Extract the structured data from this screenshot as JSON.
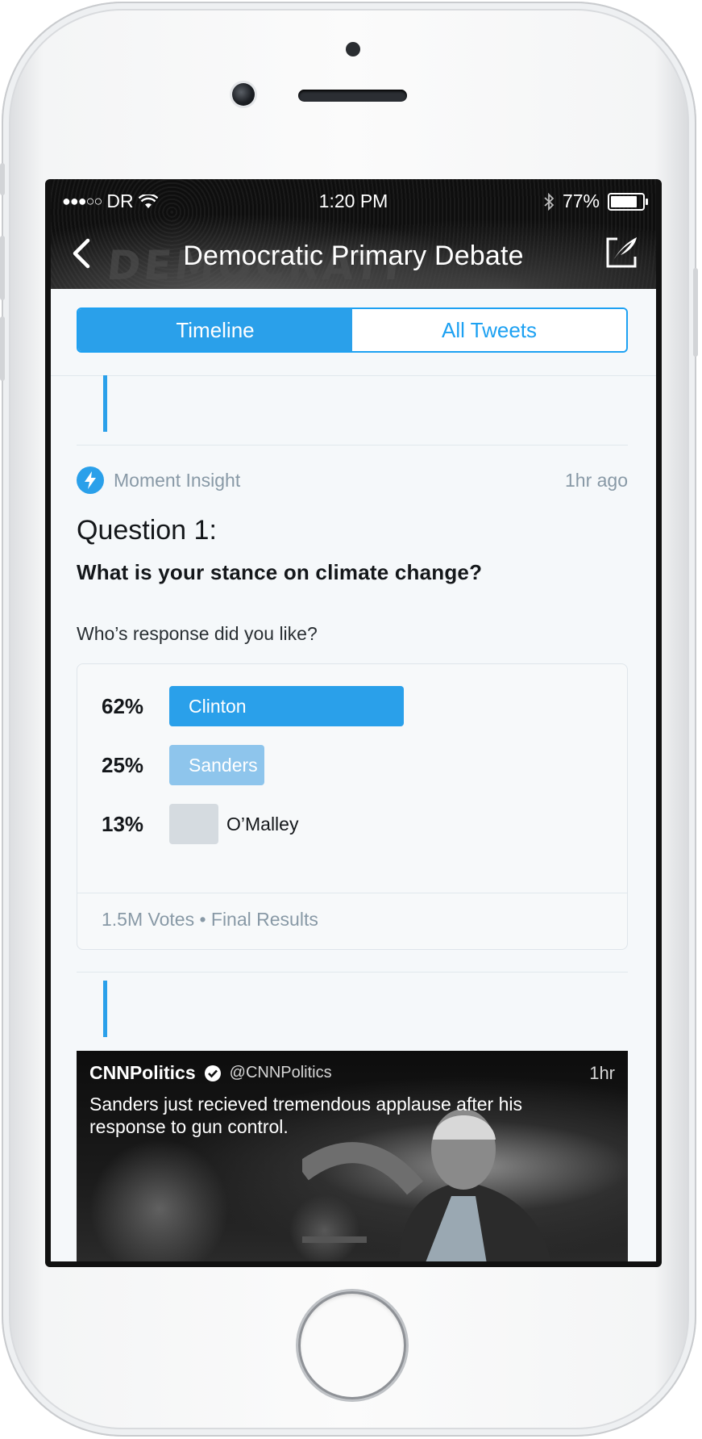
{
  "status_bar": {
    "signal": "●●●○○",
    "carrier": "DR",
    "time": "1:20 PM",
    "battery": "77%",
    "battery_level": 0.77
  },
  "nav": {
    "banner_text": "DEMOCRATI",
    "title": "Democratic Primary Debate",
    "back_icon": "chevron-left-icon",
    "compose_icon": "compose-tweet-icon"
  },
  "tabs": [
    {
      "label": "Timeline",
      "active": true
    },
    {
      "label": "All Tweets",
      "active": false
    }
  ],
  "insight": {
    "label": "Moment Insight",
    "time": "1hr ago",
    "icon": "lightning-bolt-icon",
    "question_number": "Question 1:",
    "question": "What is your stance on climate change?"
  },
  "poll": {
    "prompt": "Who’s response did you like?",
    "options": [
      {
        "percent": "62%",
        "value": 62,
        "label": "Clinton"
      },
      {
        "percent": "25%",
        "value": 25,
        "label": "Sanders"
      },
      {
        "percent": "13%",
        "value": 13,
        "label": "O’Malley"
      }
    ],
    "footer": "1.5M Votes • Final Results"
  },
  "tweet": {
    "name": "CNNPolitics",
    "handle": "@CNNPolitics",
    "time": "1hr",
    "text": "Sanders just recieved tremendous applause after his response to gun control.",
    "verified": true
  },
  "colors": {
    "accent": "#2aa0ea",
    "secondary_text": "#8899a6"
  }
}
